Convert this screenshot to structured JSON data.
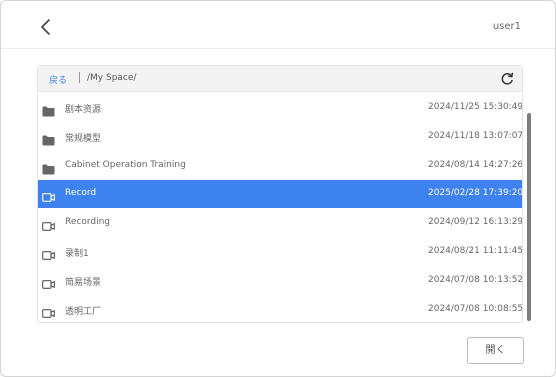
{
  "header": {
    "back_icon": "chevron-left-icon",
    "username": "user1"
  },
  "pathbar": {
    "back_label": "戻る",
    "path": "/My Space/",
    "refresh_icon": "refresh-icon"
  },
  "files": [
    {
      "type": "folder",
      "icon": "folder-icon",
      "name": "剧本资源",
      "date": "2024/11/25 15:30:49",
      "selected": false
    },
    {
      "type": "folder",
      "icon": "folder-icon",
      "name": "常规模型",
      "date": "2024/11/18 13:07:07",
      "selected": false
    },
    {
      "type": "folder",
      "icon": "folder-icon",
      "name": "Cabinet Operation Training",
      "date": "2024/08/14 14:27:26",
      "selected": false
    },
    {
      "type": "recording",
      "icon": "video-camera-icon",
      "name": "Record",
      "date": "2025/02/28 17:39:20",
      "selected": true
    },
    {
      "type": "recording",
      "icon": "video-camera-icon",
      "name": "Recording",
      "date": "2024/09/12 16:13:29",
      "selected": false
    },
    {
      "type": "recording",
      "icon": "video-camera-icon",
      "name": "录制1",
      "date": "2024/08/21 11:11:45",
      "selected": false
    },
    {
      "type": "recording",
      "icon": "video-camera-icon",
      "name": "简易场景",
      "date": "2024/07/08 10:13:52",
      "selected": false
    },
    {
      "type": "recording",
      "icon": "video-camera-icon",
      "name": "透明工厂",
      "date": "2024/07/08 10:08:55",
      "selected": false
    }
  ],
  "footer": {
    "open_label": "開く"
  },
  "colors": {
    "selection": "#3d82ee",
    "link": "#3a7fe8",
    "scrollbar": "#7d7d7d"
  }
}
